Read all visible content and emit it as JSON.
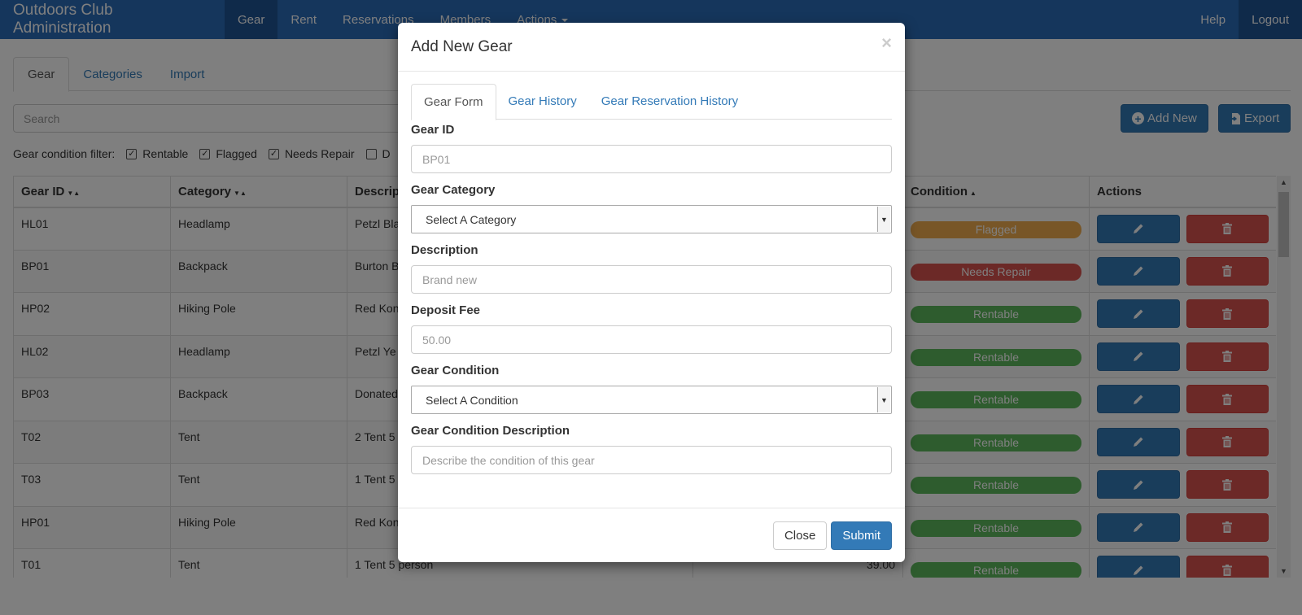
{
  "navbar": {
    "brand": "Outdoors Club Administration",
    "items": [
      "Gear",
      "Rent",
      "Reservations",
      "Members",
      "Actions"
    ],
    "help": "Help",
    "logout": "Logout"
  },
  "page_tabs": [
    "Gear",
    "Categories",
    "Import"
  ],
  "search": {
    "placeholder": "Search"
  },
  "toolbar": {
    "add_new": "Add New",
    "export": "Export"
  },
  "filter": {
    "label": "Gear condition filter:",
    "options": [
      {
        "label": "Rentable",
        "checked": true
      },
      {
        "label": "Flagged",
        "checked": true
      },
      {
        "label": "Needs Repair",
        "checked": true
      },
      {
        "label": "D",
        "checked": false
      }
    ]
  },
  "table": {
    "headers": [
      "Gear ID",
      "Category",
      "Descrip",
      "",
      "Condition",
      "Actions"
    ],
    "rows": [
      {
        "id": "HL01",
        "category": "Headlamp",
        "description": "Petzl Bla",
        "fee": "",
        "condition": "Flagged"
      },
      {
        "id": "BP01",
        "category": "Backpack",
        "description": "Burton B",
        "fee": "",
        "condition": "Needs Repair"
      },
      {
        "id": "HP02",
        "category": "Hiking Pole",
        "description": "Red Kon",
        "fee": "",
        "condition": "Rentable"
      },
      {
        "id": "HL02",
        "category": "Headlamp",
        "description": "Petzl Ye",
        "fee": "",
        "condition": "Rentable"
      },
      {
        "id": "BP03",
        "category": "Backpack",
        "description": "Donated",
        "fee": "",
        "condition": "Rentable"
      },
      {
        "id": "T02",
        "category": "Tent",
        "description": "2 Tent 5",
        "fee": "",
        "condition": "Rentable"
      },
      {
        "id": "T03",
        "category": "Tent",
        "description": "1 Tent 5",
        "fee": "",
        "condition": "Rentable"
      },
      {
        "id": "HP01",
        "category": "Hiking Pole",
        "description": "Red Kon",
        "fee": "",
        "condition": "Rentable"
      },
      {
        "id": "T01",
        "category": "Tent",
        "description": "1 Tent 5 person",
        "fee": "39.00",
        "condition": "Rentable"
      }
    ]
  },
  "condition_colors": {
    "Flagged": "#f0ad4e",
    "Needs Repair": "#d9534f",
    "Rentable": "#5cb85c"
  },
  "modal": {
    "title": "Add New Gear",
    "close_symbol": "×",
    "tabs": [
      "Gear Form",
      "Gear History",
      "Gear Reservation History"
    ],
    "gear_id": {
      "label": "Gear ID",
      "placeholder": "BP01"
    },
    "category": {
      "label": "Gear Category",
      "value": "Select A Category"
    },
    "description": {
      "label": "Description",
      "placeholder": "Brand new"
    },
    "deposit": {
      "label": "Deposit Fee",
      "placeholder": "50.00"
    },
    "condition": {
      "label": "Gear Condition",
      "value": "Select A Condition"
    },
    "condition_desc": {
      "label": "Gear Condition Description",
      "placeholder": "Describe the condition of this gear"
    },
    "close_button": "Close",
    "submit_button": "Submit"
  }
}
